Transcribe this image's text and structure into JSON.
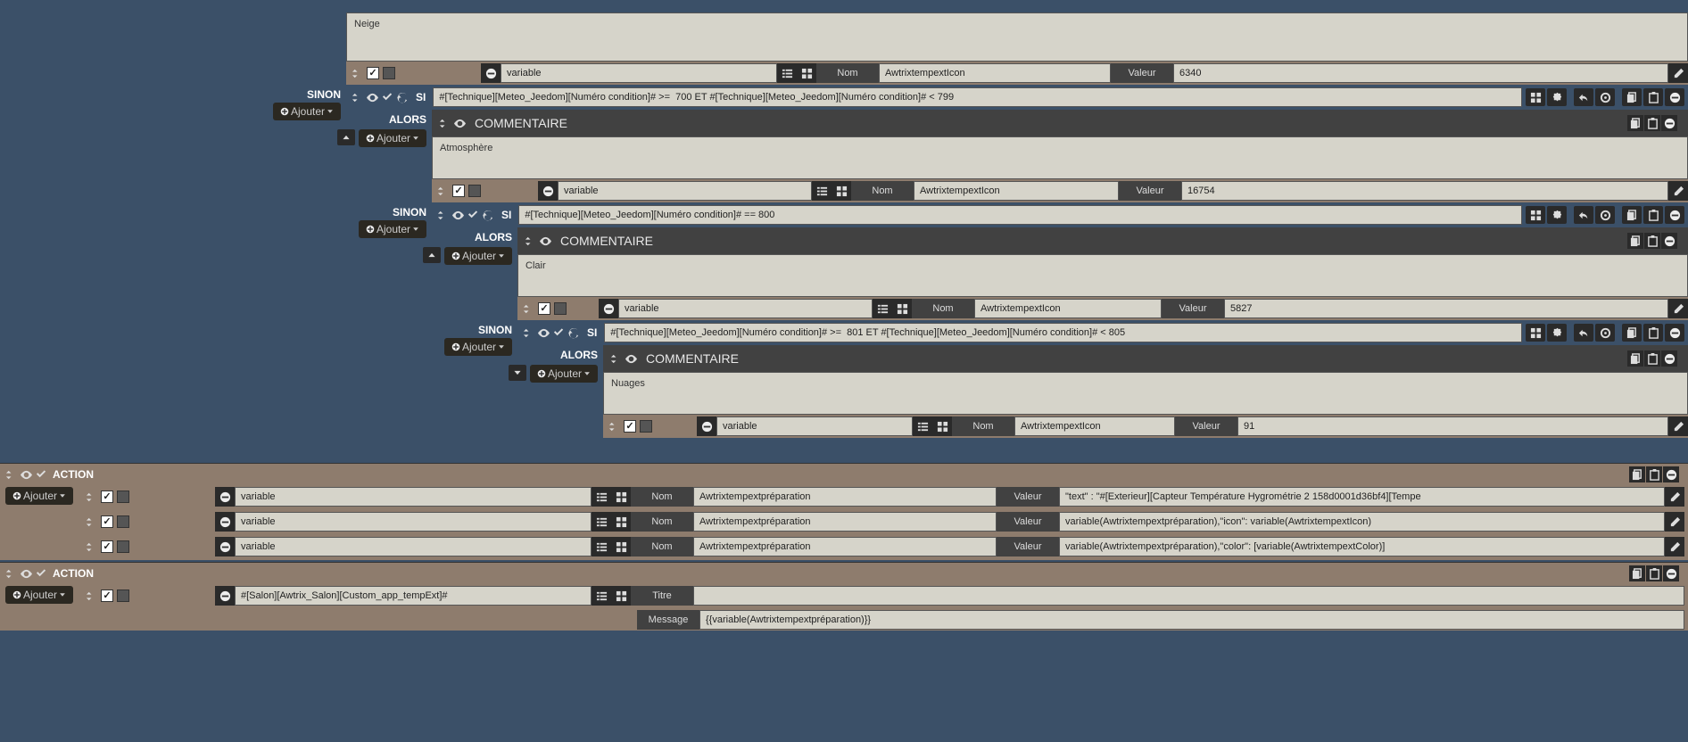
{
  "common": {
    "ajouter": "Ajouter",
    "sinon": "SINON",
    "si": "SI",
    "alors": "ALORS",
    "commentaire": "COMMENTAIRE",
    "variable": "variable",
    "nom": "Nom",
    "valeur": "Valeur",
    "titre": "Titre",
    "message": "Message",
    "action": "ACTION"
  },
  "blocks": [
    {
      "header_left_kw": "Ajouter",
      "comment_text": "Neige",
      "var_name": "AwtrixtempextIcon",
      "var_value": "6340"
    },
    {
      "sinon": true,
      "condition": "#[Technique][Meteo_Jeedom][Numéro condition]# >=  700 ET #[Technique][Meteo_Jeedom][Numéro condition]# < 799",
      "comment_text": "Atmosphère",
      "var_name": "AwtrixtempextIcon",
      "var_value": "16754"
    },
    {
      "sinon": true,
      "condition": "#[Technique][Meteo_Jeedom][Numéro condition]# == 800",
      "comment_text": "Clair",
      "var_name": "AwtrixtempextIcon",
      "var_value": "5827"
    },
    {
      "sinon": true,
      "condition": "#[Technique][Meteo_Jeedom][Numéro condition]# >=  801 ET #[Technique][Meteo_Jeedom][Numéro condition]# < 805",
      "comment_text": "Nuages",
      "var_name": "AwtrixtempextIcon",
      "var_value": "91"
    }
  ],
  "actions1": [
    {
      "type": "variable",
      "name": "Awtrixtempextpréparation",
      "value": "\"text\" : \"#[Exterieur][Capteur Température Hygrométrie 2 158d0001d36bf4][Tempe"
    },
    {
      "type": "variable",
      "name": "Awtrixtempextpréparation",
      "value": "variable(Awtrixtempextpréparation),\"icon\": variable(AwtrixtempextIcon)"
    },
    {
      "type": "variable",
      "name": "Awtrixtempextpréparation",
      "value": "variable(Awtrixtempextpréparation),\"color\": [variable(AwtrixtempextColor)]"
    }
  ],
  "actions2": {
    "cmd": "#[Salon][Awtrix_Salon][Custom_app_tempExt]#",
    "message": "{{variable(Awtrixtempextpréparation)}}"
  }
}
